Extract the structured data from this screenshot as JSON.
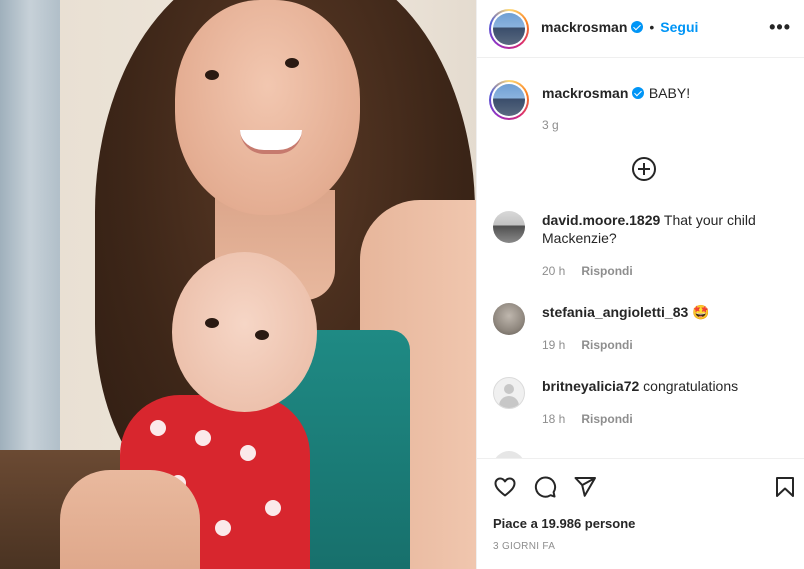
{
  "post": {
    "author": "mackrosman",
    "follow_label": "Segui",
    "separator": "•",
    "more_label": "•••",
    "caption": "BABY!",
    "caption_age": "3 g"
  },
  "comments": [
    {
      "user": "david.moore.1829",
      "text": "That your child Mackenzie?",
      "age": "20 h",
      "reply": "Rispondi"
    },
    {
      "user": "stefania_angioletti_83",
      "text": "🤩",
      "age": "19 h",
      "reply": "Rispondi"
    },
    {
      "user": "britneyalicia72",
      "text": "congratulations",
      "age": "18 h",
      "reply": "Rispondi"
    }
  ],
  "footer": {
    "likes": "Piace a 19.986 persone",
    "date": "3 GIORNI FA"
  },
  "icons": {
    "like": "heart-icon",
    "comment": "comment-icon",
    "share": "paper-plane-icon",
    "save": "bookmark-icon",
    "load_more": "plus-circle-icon",
    "verified": "verified-badge-icon"
  },
  "colors": {
    "accent": "#0095f6",
    "muted": "#8e8e8e",
    "text": "#262626"
  }
}
